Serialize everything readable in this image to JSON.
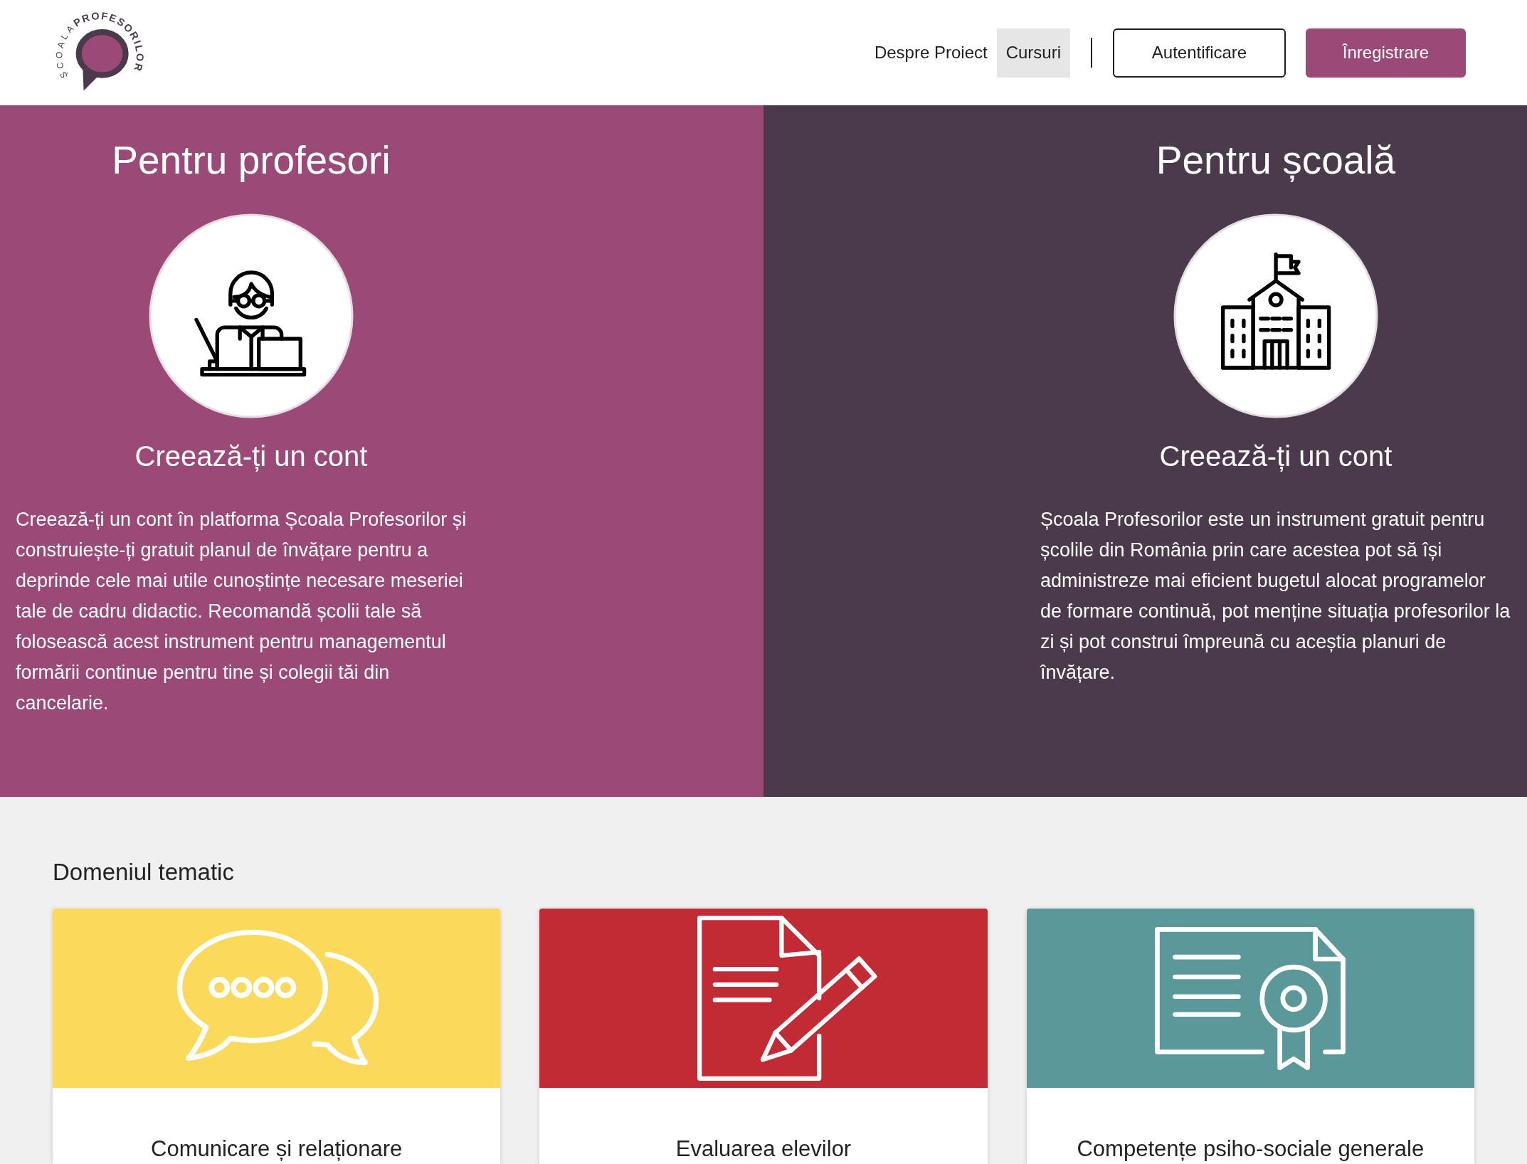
{
  "header": {
    "logo": {
      "text_1": "ȘCOALA",
      "text_2": "PROFESORILOR"
    },
    "nav": [
      {
        "label": "Despre Proiect",
        "selected": false
      },
      {
        "label": "Cursuri",
        "selected": true
      }
    ],
    "buttons": [
      {
        "label": "Autentificare",
        "kind": "outline"
      },
      {
        "label": "Înregistrare",
        "kind": "filled"
      }
    ]
  },
  "audiences": [
    {
      "title": "Pentru profesori",
      "color": "#9b4977",
      "subtitle": "Creează-ți un cont",
      "text": "Creează-ți un cont în platforma Școala Profesorilor și construiește-ți gratuit planul de învățare pentru a deprinde cele mai utile cunoștințe necesare meseriei tale de cadru didactic. Recomandă școlii tale să folosească acest instrument pentru managementul formării continue pentru tine și colegii tăi din cancelarie."
    },
    {
      "title": "Pentru școală",
      "color": "#4b3a4b",
      "subtitle": "Creează-ți un cont",
      "text": "Școala Profesorilor este un instrument gratuit pentru școlile din România prin care acestea pot să își administreze mai eficient bugetul alocat programelor de formare continuă, pot menține situația profesorilor la zi și pot construi împreună cu aceștia planuri de învățare."
    }
  ],
  "topics": {
    "heading": "Domeniul tematic",
    "items": [
      {
        "title": "Comunicare și relaționare",
        "color": "#fbd95b"
      },
      {
        "title": "Evaluarea elevilor",
        "color": "#c22a34"
      },
      {
        "title": "Competențe psiho-sociale generale",
        "color": "#5b989a"
      }
    ]
  }
}
